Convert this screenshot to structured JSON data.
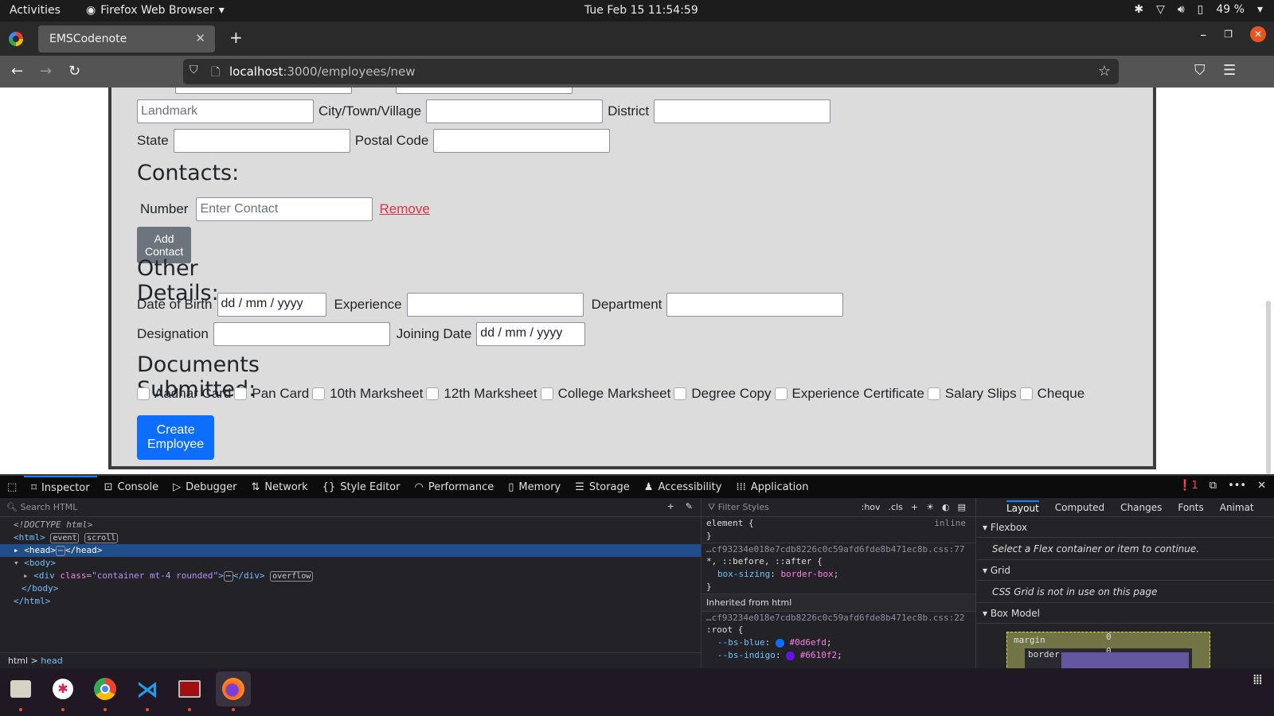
{
  "topbar": {
    "activities": "Activities",
    "app_name": "Firefox Web Browser",
    "clock": "Tue Feb 15  11:54:59",
    "battery": "49 %"
  },
  "browser": {
    "tab_title": "EMSCodenote",
    "url_host": "localhost",
    "url_path": ":3000/employees/new"
  },
  "form": {
    "address": {
      "landmark_placeholder": "Landmark",
      "city_label": "City/Town/Village",
      "district_label": "District",
      "state_label": "State",
      "postal_label": "Postal Code"
    },
    "contacts": {
      "heading": "Contacts:",
      "number_label": "Number",
      "number_placeholder": "Enter Contact",
      "remove_label": "Remove",
      "add_label": "Add Contact"
    },
    "other": {
      "heading": "Other Details:",
      "dob_label": "Date of Birth",
      "dob_value": "dd / mm / yyyy",
      "experience_label": "Experience",
      "department_label": "Department",
      "designation_label": "Designation",
      "joining_label": "Joining Date",
      "joining_value": "dd / mm / yyyy"
    },
    "documents": {
      "heading": "Documents Submitted:",
      "items": [
        {
          "label": "Aadhar Card",
          "checked": false
        },
        {
          "label": "Pan Card",
          "checked": false
        },
        {
          "label": "10th Marksheet",
          "checked": false
        },
        {
          "label": "12th Marksheet",
          "checked": false
        },
        {
          "label": "College Marksheet",
          "checked": false
        },
        {
          "label": "Degree Copy",
          "checked": false
        },
        {
          "label": "Experience Certificate",
          "checked": false
        },
        {
          "label": "Salary Slips",
          "checked": false
        },
        {
          "label": "Cheque",
          "checked": false
        }
      ]
    },
    "submit_label": "Create Employee"
  },
  "devtools": {
    "tools": [
      "Inspector",
      "Console",
      "Debugger",
      "Network",
      "Style Editor",
      "Performance",
      "Memory",
      "Storage",
      "Accessibility",
      "Application"
    ],
    "error_count": "1",
    "search_placeholder": "Search HTML",
    "tree": {
      "doctype": "<!DOCTYPE html>",
      "html_open": "<html>",
      "badge_event": "event",
      "badge_scroll": "scroll",
      "head": "<head>",
      "head_close": "</head>",
      "body_open": "<body>",
      "div_tag": "<div",
      "div_attr": "class",
      "div_val": "\"container mt-4 rounded\"",
      "div_close": "</div>",
      "badge_overflow": "overflow",
      "body_close": "</body>",
      "html_close": "</html>"
    },
    "breadcrumbs": [
      "html",
      "head"
    ],
    "rules": {
      "filter_placeholder": "Filter Styles",
      "hov": ":hov",
      "cls": ".cls",
      "element_rule": "element {",
      "inline": "inline",
      "src1": "…cf93234e018e7cdb8226c0c59afd6fde8b471ec8b.css:77",
      "selector1": "*, ::before, ::after",
      "prop1": "box-sizing",
      "val1": "border-box",
      "inherited": "Inherited from html",
      "src2": "…cf93234e018e7cdb8226c0c59afd6fde8b471ec8b.css:22",
      "selector2": ":root",
      "vars": [
        {
          "name": "--bs-blue",
          "value": "#0d6efd",
          "color": "#0d6efd"
        },
        {
          "name": "--bs-indigo",
          "value": "#6610f2",
          "color": "#6610f2"
        }
      ]
    },
    "layout": {
      "tabs": [
        "Layout",
        "Computed",
        "Changes",
        "Fonts",
        "Animat"
      ],
      "flexbox": "Flexbox",
      "flexbox_msg": "Select a Flex container or item to continue.",
      "grid": "Grid",
      "grid_msg": "CSS Grid is not in use on this page",
      "boxmodel": "Box Model",
      "margin_label": "margin",
      "margin_value": "0",
      "border_label": "border",
      "border_value": "0"
    }
  },
  "dock": [
    "Files",
    "Slack",
    "Chrome",
    "VS Code",
    "Terminal",
    "Firefox"
  ]
}
